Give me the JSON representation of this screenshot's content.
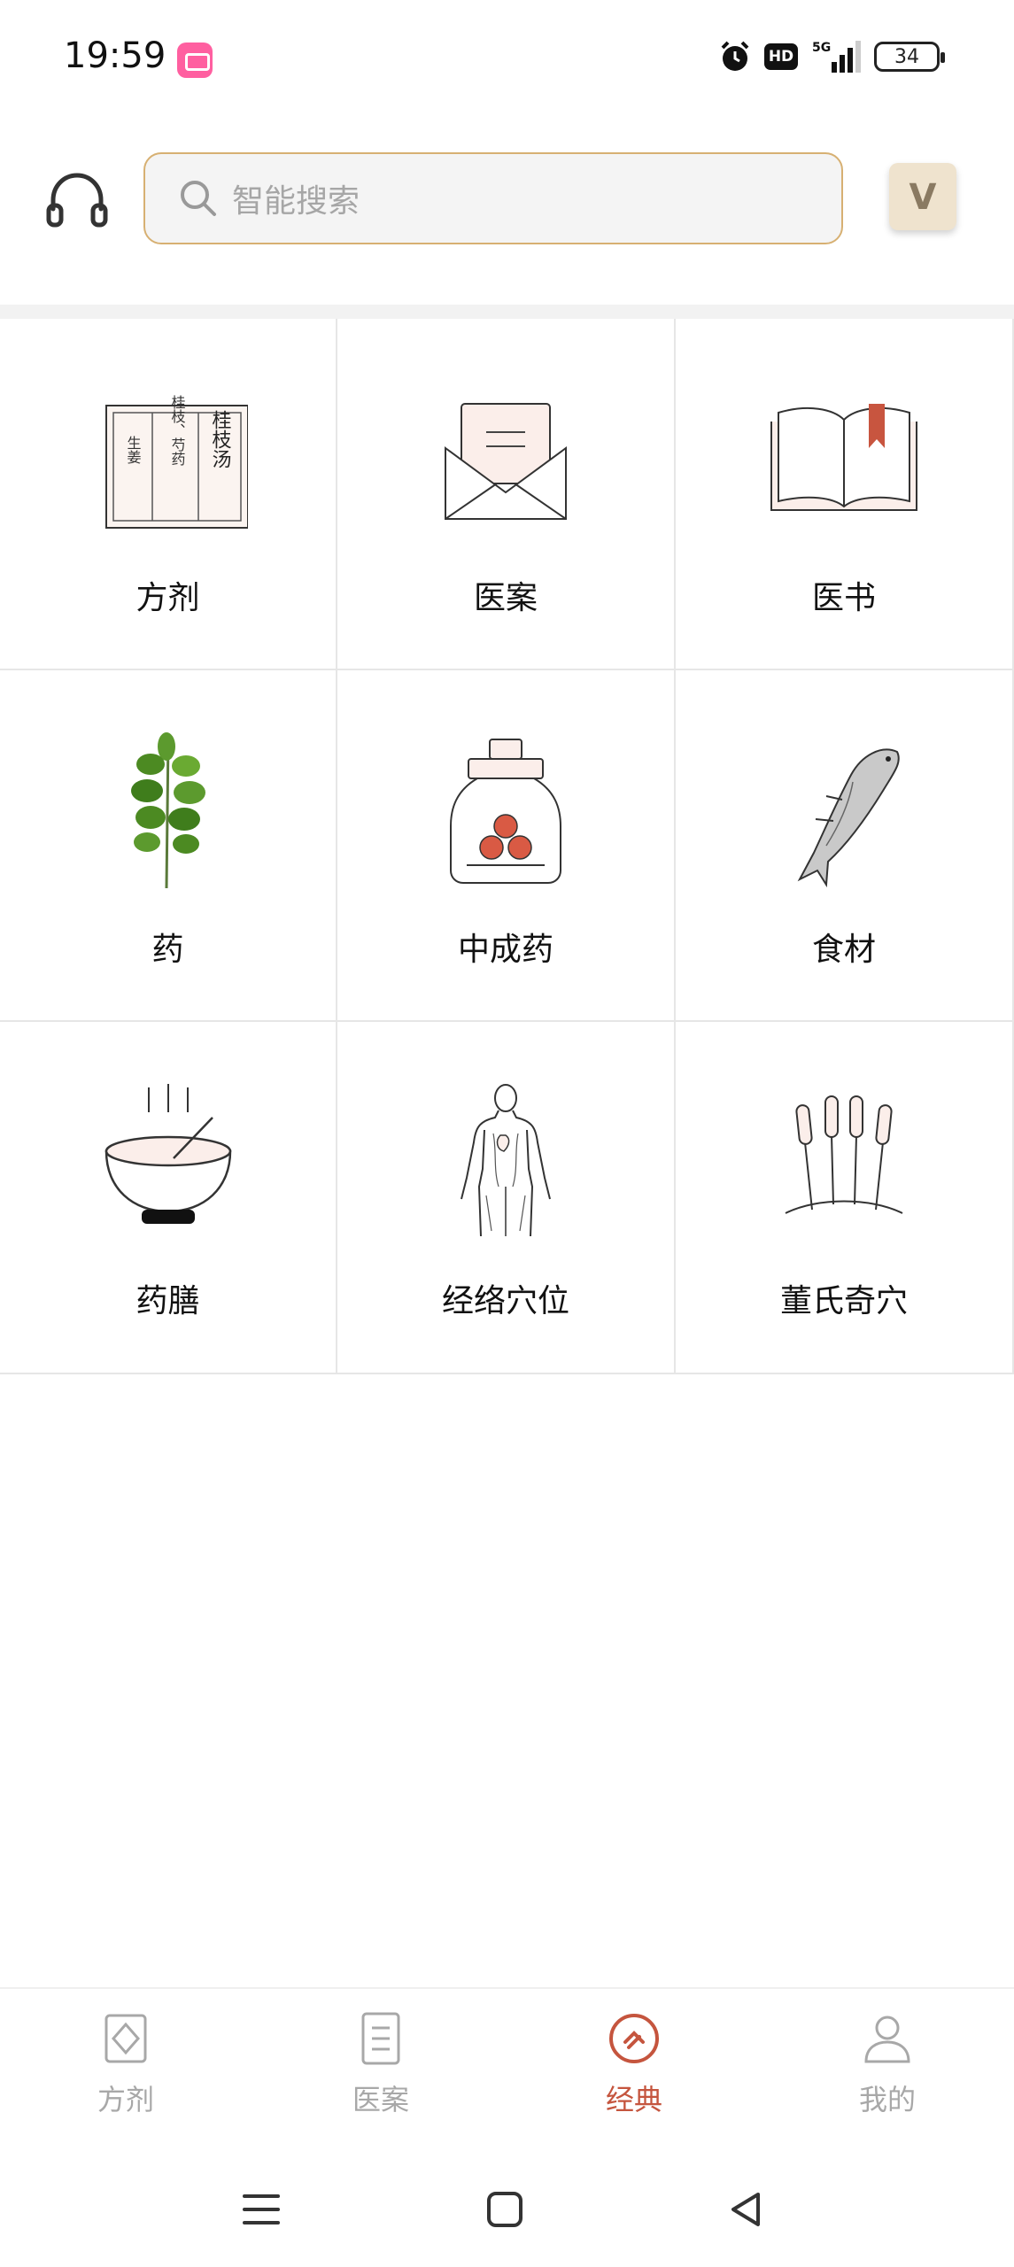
{
  "status_bar": {
    "time": "19:59",
    "hd": "HD",
    "network": "5G",
    "battery": "34"
  },
  "header": {
    "search_placeholder": "智能搜索",
    "vip_letter": "V",
    "search_border_color": "#d7b072"
  },
  "grid": {
    "items": [
      {
        "label": "方剂",
        "icon": "prescription-scroll-icon"
      },
      {
        "label": "医案",
        "icon": "envelope-letter-icon"
      },
      {
        "label": "医书",
        "icon": "open-book-icon"
      },
      {
        "label": "药",
        "icon": "herb-plant-icon"
      },
      {
        "label": "中成药",
        "icon": "medicine-jar-icon"
      },
      {
        "label": "食材",
        "icon": "fish-icon"
      },
      {
        "label": "药膳",
        "icon": "soup-bowl-icon"
      },
      {
        "label": "经络穴位",
        "icon": "human-body-meridian-icon"
      },
      {
        "label": "董氏奇穴",
        "icon": "acupuncture-needles-icon"
      }
    ],
    "prescription_card": {
      "title": "桂枝汤",
      "line1": "桂枝、芍药",
      "line2": "生姜"
    }
  },
  "bottom_nav": {
    "items": [
      {
        "label": "方剂",
        "active": false
      },
      {
        "label": "医案",
        "active": false
      },
      {
        "label": "经典",
        "active": true
      },
      {
        "label": "我的",
        "active": false
      }
    ],
    "active_color": "#c5553e",
    "inactive_color": "#a8a8a8"
  }
}
